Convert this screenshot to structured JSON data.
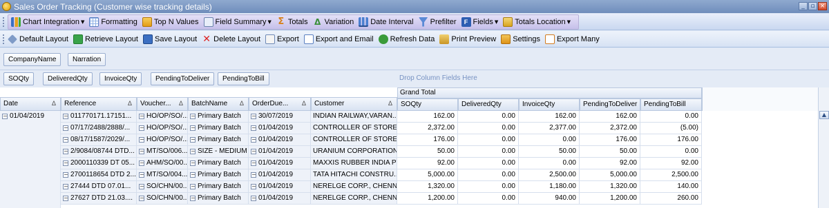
{
  "window": {
    "title": "Sales Order Tracking (Customer wise tracking details)",
    "minimize": "_",
    "restore": "▫",
    "close": "×"
  },
  "toolbar1": [
    {
      "label": "Chart Integration",
      "icon": "chart-icon",
      "dropdown": true
    },
    {
      "label": "Formatting",
      "icon": "formatting-icon",
      "dropdown": false
    },
    {
      "label": "Top N Values",
      "icon": "top-n-icon",
      "dropdown": false
    },
    {
      "label": "Field Summary",
      "icon": "field-summary-icon",
      "dropdown": true
    },
    {
      "label": "Totals",
      "icon": "sigma-icon",
      "dropdown": false
    },
    {
      "label": "Variation",
      "icon": "variation-icon",
      "dropdown": false
    },
    {
      "label": "Date Interval",
      "icon": "date-interval-icon",
      "dropdown": false
    },
    {
      "label": "Prefilter",
      "icon": "prefilter-icon",
      "dropdown": false
    },
    {
      "label": "Fields",
      "icon": "fields-icon",
      "dropdown": true
    },
    {
      "label": "Totals Location",
      "icon": "totals-location-icon",
      "dropdown": true
    }
  ],
  "toolbar2": [
    {
      "label": "Default Layout",
      "icon": "default-layout-icon"
    },
    {
      "label": "Retrieve Layout",
      "icon": "retrieve-layout-icon"
    },
    {
      "label": "Save Layout",
      "icon": "save-layout-icon"
    },
    {
      "label": "Delete Layout",
      "icon": "delete-layout-icon"
    },
    {
      "label": "Export",
      "icon": "export-icon"
    },
    {
      "label": "Export and Email",
      "icon": "export-email-icon"
    },
    {
      "label": "Refresh Data",
      "icon": "refresh-icon"
    },
    {
      "label": "Print Preview",
      "icon": "print-preview-icon"
    },
    {
      "label": "Settings",
      "icon": "settings-icon"
    },
    {
      "label": "Export Many",
      "icon": "export-many-icon"
    }
  ],
  "filter_fields": [
    "CompanyName",
    "Narration"
  ],
  "data_fields": [
    "SOQty",
    "DeliveredQty",
    "InvoiceQty",
    "PendingToDeliver",
    "PendingToBill"
  ],
  "drop_column_hint": "Drop Column Fields Here",
  "grand_total_label": "Grand Total",
  "sort_glyph": "Δ",
  "row_headers": [
    "Date",
    "Reference",
    "Voucher...",
    "BatchName",
    "OrderDue...",
    "Customer"
  ],
  "value_headers": [
    "SOQty",
    "DeliveredQty",
    "InvoiceQty",
    "PendingToDeliver",
    "PendingToBill"
  ],
  "date_value": "01/04/2019",
  "rows": [
    {
      "reference": "011770171.17151...",
      "voucher": "HO/OP/SO/...",
      "batch": "Primary Batch",
      "due": "30/07/2019",
      "customer": "INDIAN RAILWAY,VARAN...",
      "values": [
        "162.00",
        "0.00",
        "162.00",
        "162.00",
        "0.00"
      ]
    },
    {
      "reference": "07/17/2488/2888/...",
      "voucher": "HO/OP/SO/...",
      "batch": "Primary Batch",
      "due": "01/04/2019",
      "customer": "CONTROLLER OF STORES...",
      "values": [
        "2,372.00",
        "0.00",
        "2,377.00",
        "2,372.00",
        "(5.00)"
      ]
    },
    {
      "reference": "08/17/1587/2029/...",
      "voucher": "HO/OP/SO/...",
      "batch": "Primary Batch",
      "due": "01/04/2019",
      "customer": "CONTROLLER OF STORES...",
      "values": [
        "176.00",
        "0.00",
        "0.00",
        "176.00",
        "176.00"
      ]
    },
    {
      "reference": "2/9084/08744 DTD...",
      "voucher": "MT/SO/006...",
      "batch": "SIZE - MEDIUM",
      "due": "01/04/2019",
      "customer": "URANIUM CORPORATION...",
      "values": [
        "50.00",
        "0.00",
        "50.00",
        "50.00",
        "0.00"
      ]
    },
    {
      "reference": "2000110339 DT 05...",
      "voucher": "AHM/SO/00...",
      "batch": "Primary Batch",
      "due": "01/04/2019",
      "customer": "MAXXIS RUBBER INDIA PV...",
      "values": [
        "92.00",
        "0.00",
        "0.00",
        "92.00",
        "92.00"
      ]
    },
    {
      "reference": "2700118654 DTD 2...",
      "voucher": "MT/SO/004...",
      "batch": "Primary Batch",
      "due": "01/04/2019",
      "customer": "TATA HITACHI CONSTRU...",
      "values": [
        "5,000.00",
        "0.00",
        "2,500.00",
        "5,000.00",
        "2,500.00"
      ]
    },
    {
      "reference": "27444 DTD 07.01...",
      "voucher": "SO/CHN/00...",
      "batch": "Primary Batch",
      "due": "01/04/2019",
      "customer": "NERELGE CORP., CHENNAI",
      "values": [
        "1,320.00",
        "0.00",
        "1,180.00",
        "1,320.00",
        "140.00"
      ]
    },
    {
      "reference": "27627 DTD 21.03....",
      "voucher": "SO/CHN/00...",
      "batch": "Primary Batch",
      "due": "01/04/2019",
      "customer": "NERELGE CORP., CHENNAI",
      "values": [
        "1,200.00",
        "0.00",
        "940.00",
        "1,200.00",
        "260.00"
      ]
    }
  ]
}
